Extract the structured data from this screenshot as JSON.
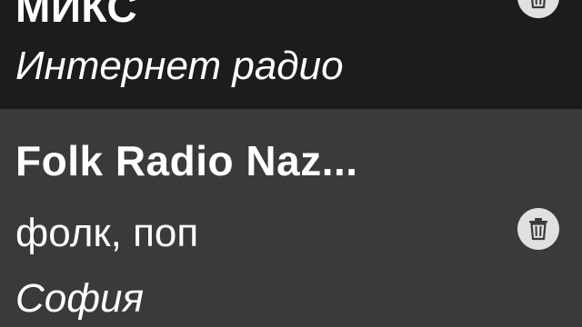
{
  "stations": [
    {
      "title": "МИКС",
      "genre": "",
      "subtitle": "Интернет радио",
      "delete_icon": "trash-icon",
      "selected": false
    },
    {
      "title": "Folk Radio Naz...",
      "genre": "фолк, поп",
      "subtitle": "София",
      "delete_icon": "trash-icon",
      "selected": true
    }
  ],
  "colors": {
    "background": "#1c1c1e",
    "selected_row": "#3a3a3c",
    "text": "#ffffff",
    "icon_bg": "#e0e0e0",
    "icon_fg": "#3a3a3c"
  }
}
